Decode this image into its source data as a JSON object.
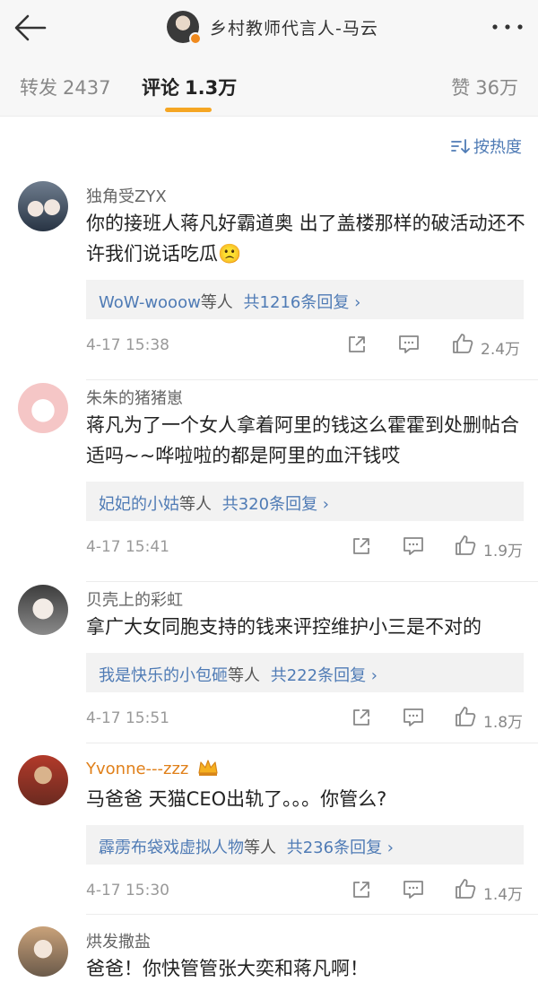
{
  "header": {
    "title": "乡村教师代言人-马云",
    "avatar_icon": "user-avatar",
    "verified_icon": "verified-badge-icon",
    "back_icon": "back-arrow-icon",
    "more_icon": "more-dots-icon"
  },
  "tabs": [
    {
      "label": "转发",
      "count": "2437"
    },
    {
      "label": "评论",
      "count": "1.3万"
    },
    {
      "label": "赞",
      "count": "36万"
    }
  ],
  "sort": {
    "label": "按热度",
    "icon": "sort-icon"
  },
  "comments": [
    {
      "name": "独角受ZYX",
      "text": "你的接班人蒋凡好霸道奥 出了盖楼那样的破活动还不许我们说话吃瓜🙁",
      "replies": {
        "who": "WoW-wooow",
        "suffix": "等人",
        "count": "共1216条回复 ›"
      },
      "time": "4-17 15:38",
      "likes": "2.4万"
    },
    {
      "name": "朱朱的猪猪崽",
      "text": "蒋凡为了一个女人拿着阿里的钱这么霍霍到处删帖合适吗~~哗啦啦的都是阿里的血汗钱哎",
      "replies": {
        "who": "妃妃的小姑",
        "suffix": "等人",
        "count": "共320条回复 ›"
      },
      "time": "4-17 15:41",
      "likes": "1.9万"
    },
    {
      "name": "贝壳上的彩虹",
      "text": "拿广大女同胞支持的钱来评控维护小三是不对的",
      "replies": {
        "who": "我是快乐的小包砸",
        "suffix": "等人",
        "count": "共222条回复 ›"
      },
      "time": "4-17 15:51",
      "likes": "1.8万"
    },
    {
      "name": "Yvonne---zzz",
      "text": "马爸爸  天猫CEO出轨了。。。你管么?",
      "replies": {
        "who": "霹雳布袋戏虚拟人物",
        "suffix": "等人",
        "count": "共236条回复 ›"
      },
      "time": "4-17 15:30",
      "likes": "1.4万"
    },
    {
      "name": "烘发撒盐",
      "text": "爸爸！你快管管张大奕和蒋凡啊！"
    }
  ]
}
